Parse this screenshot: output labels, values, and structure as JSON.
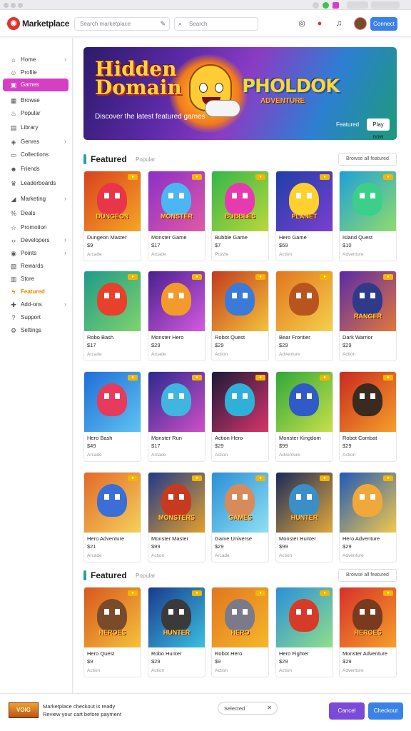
{
  "app": {
    "title": "Marketplace"
  },
  "header": {
    "search_placeholder": "Search marketplace",
    "search2_placeholder": "Search",
    "primary_button": "Connect"
  },
  "sidebar": {
    "items": [
      {
        "label": "Home",
        "icon": "home-icon",
        "chevron": true
      },
      {
        "label": "Profile",
        "icon": "user-icon",
        "chevron": false
      },
      {
        "label": "Games",
        "icon": "gamepad-icon",
        "chevron": false,
        "active": true
      },
      {
        "label": "Browse",
        "icon": "grid-icon",
        "chevron": false
      },
      {
        "label": "Popular",
        "icon": "fire-icon",
        "chevron": false
      },
      {
        "label": "Library",
        "icon": "book-icon",
        "chevron": false
      },
      {
        "label": "Genres",
        "icon": "tag-icon",
        "chevron": true
      },
      {
        "label": "Collections",
        "icon": "folder-icon",
        "chevron": false
      },
      {
        "label": "Friends",
        "icon": "friends-icon",
        "chevron": false
      },
      {
        "label": "Leaderboards",
        "icon": "trophy-icon",
        "chevron": false
      },
      {
        "label": "Marketing",
        "icon": "megaphone-icon",
        "chevron": true
      },
      {
        "label": "Deals",
        "icon": "percent-icon",
        "chevron": false
      },
      {
        "label": "Promotion",
        "icon": "star-icon",
        "chevron": false
      },
      {
        "label": "Developers",
        "icon": "code-icon",
        "chevron": true
      },
      {
        "label": "Points",
        "icon": "coin-icon",
        "chevron": true
      },
      {
        "label": "Rewards",
        "icon": "gift-icon",
        "chevron": false
      },
      {
        "label": "Store",
        "icon": "store-icon",
        "chevron": false
      },
      {
        "label": "Featured",
        "icon": "bolt-icon",
        "chevron": false,
        "highlight": true
      },
      {
        "label": "Add-ons",
        "icon": "puzzle-icon",
        "chevron": true
      },
      {
        "label": "Support",
        "icon": "help-icon",
        "chevron": false
      },
      {
        "label": "Settings",
        "icon": "gear-icon",
        "chevron": false
      }
    ]
  },
  "hero": {
    "title_line1": "Hidden",
    "title_line2": "Domain",
    "logo_text": "PHOLDOK",
    "logo_sub": "ADVENTURE",
    "tagline": "Discover the latest featured games",
    "promo_label": "Featured",
    "button_label": "Play now"
  },
  "sections": [
    {
      "title": "Featured",
      "subtitle": "Popular",
      "button": "Browse all featured",
      "cards": [
        {
          "title": "Dungeon Master",
          "price": "$9",
          "meta": "Arcade",
          "colors": [
            "#d9421f",
            "#f5a623"
          ],
          "blob": "#e8354a",
          "art_text": "DUNGEON"
        },
        {
          "title": "Monster Game",
          "price": "$17",
          "meta": "Arcade",
          "colors": [
            "#8b2fc9",
            "#e259a6"
          ],
          "blob": "#4bb6f2",
          "art_text": "MONSTER"
        },
        {
          "title": "Bubble Game",
          "price": "$7",
          "meta": "Puzzle",
          "colors": [
            "#35b64a",
            "#b8d83b"
          ],
          "blob": "#e83ab0",
          "art_text": "BUBBLES"
        },
        {
          "title": "Hero Game",
          "price": "$69",
          "meta": "Action",
          "colors": [
            "#1e3fa8",
            "#7a3fd0"
          ],
          "blob": "#ffd02e",
          "art_text": "PLANET"
        },
        {
          "title": "Island Quest",
          "price": "$10",
          "meta": "Adventure",
          "colors": [
            "#1fa0d8",
            "#8fdc6a"
          ],
          "blob": "#3ccf8a",
          "art_text": ""
        }
      ]
    },
    {
      "title": "",
      "cards": [
        {
          "title": "Robo Bash",
          "price": "$17",
          "meta": "Arcade",
          "colors": [
            "#1e9b8a",
            "#7fd36b"
          ],
          "blob": "#e8402a",
          "art_text": ""
        },
        {
          "title": "Monster Hero",
          "price": "$29",
          "meta": "Arcade",
          "colors": [
            "#4a1f8f",
            "#d45be0"
          ],
          "blob": "#f29b2a",
          "art_text": ""
        },
        {
          "title": "Robot Quest",
          "price": "$29",
          "meta": "Action",
          "colors": [
            "#c23b1f",
            "#f5c23a"
          ],
          "blob": "#3a7ad8",
          "art_text": ""
        },
        {
          "title": "Bear Frontier",
          "price": "$29",
          "meta": "Adventure",
          "colors": [
            "#e2761f",
            "#f5d04a"
          ],
          "blob": "#b8551f",
          "art_text": ""
        },
        {
          "title": "Dark Warrior",
          "price": "$29",
          "meta": "Action",
          "colors": [
            "#5a2aa8",
            "#e2783a"
          ],
          "blob": "#2f3a8a",
          "art_text": "RANGER"
        }
      ]
    },
    {
      "title": "",
      "cards": [
        {
          "title": "Hero Bash",
          "price": "$49",
          "meta": "Arcade",
          "colors": [
            "#1f6fd8",
            "#5fc2f2"
          ],
          "blob": "#e83a5a",
          "art_text": ""
        },
        {
          "title": "Monster Run",
          "price": "$17",
          "meta": "Arcade",
          "colors": [
            "#2a2a8f",
            "#d04fc8"
          ],
          "blob": "#3fb6e0",
          "art_text": ""
        },
        {
          "title": "Action Hero",
          "price": "$29",
          "meta": "Action",
          "colors": [
            "#1a1a3a",
            "#d8346a"
          ],
          "blob": "#2fb0d8",
          "art_text": ""
        },
        {
          "title": "Monster Kingdom",
          "price": "$99",
          "meta": "Adventure",
          "colors": [
            "#2fa83a",
            "#c8e04a"
          ],
          "blob": "#2f5ac8",
          "art_text": ""
        },
        {
          "title": "Robot Combat",
          "price": "$29",
          "meta": "Action",
          "colors": [
            "#c82a1f",
            "#f5a02a"
          ],
          "blob": "#3a2a1f",
          "art_text": ""
        }
      ]
    },
    {
      "title": "",
      "cards": [
        {
          "title": "Hero Adventure",
          "price": "$21",
          "meta": "Arcade",
          "colors": [
            "#e26a2a",
            "#f5d05a"
          ],
          "blob": "#3a6fd8",
          "art_text": ""
        },
        {
          "title": "Monster Master",
          "price": "$99",
          "meta": "Action",
          "colors": [
            "#1f3a8a",
            "#e2a02a"
          ],
          "blob": "#c83a1f",
          "art_text": "MONSTERS"
        },
        {
          "title": "Game Universe",
          "price": "$29",
          "meta": "Arcade",
          "colors": [
            "#2a8fd8",
            "#8fe0f2"
          ],
          "blob": "#d88a5a",
          "art_text": "GAMES"
        },
        {
          "title": "Monster Hunter",
          "price": "$99",
          "meta": "Action",
          "colors": [
            "#1a2a5a",
            "#e2a83a"
          ],
          "blob": "#3a8fc8",
          "art_text": "HUNTER"
        },
        {
          "title": "Hero Adventure",
          "price": "$29",
          "meta": "Adventure",
          "colors": [
            "#1f5ab8",
            "#f2c84a"
          ],
          "blob": "#f0a83a",
          "art_text": ""
        }
      ]
    },
    {
      "title": "Featured",
      "subtitle": "Popular",
      "button": "Browse all featured",
      "cards": [
        {
          "title": "Hero Quest",
          "price": "$9",
          "meta": "Action",
          "colors": [
            "#d8571f",
            "#f5c23a"
          ],
          "blob": "#7a4b2a",
          "art_text": "HEROES"
        },
        {
          "title": "Robo Hunter",
          "price": "$29",
          "meta": "Action",
          "colors": [
            "#1a3a8f",
            "#3ac0e0"
          ],
          "blob": "#3a3a3a",
          "art_text": "HUNTER"
        },
        {
          "title": "Robot Hero",
          "price": "$9",
          "meta": "Action",
          "colors": [
            "#e2761f",
            "#f5b82a"
          ],
          "blob": "#7a7a8a",
          "art_text": "HERO"
        },
        {
          "title": "Hero Fighter",
          "price": "$29",
          "meta": "Action",
          "colors": [
            "#2a8fd8",
            "#8fe08a"
          ],
          "blob": "#d83a2a",
          "art_text": ""
        },
        {
          "title": "Monster Adventure",
          "price": "$29",
          "meta": "Adventure",
          "colors": [
            "#d8302a",
            "#f5a02a"
          ],
          "blob": "#7a3a1f",
          "art_text": "HEROES"
        }
      ]
    }
  ],
  "bottombar": {
    "thumb_text": "VOIG",
    "line1": "Marketplace checkout is ready",
    "line2": "Review your cart before payment",
    "pill_label": "Selected",
    "btn1": "Cancel",
    "btn2": "Checkout",
    "btn1_color": "#7b4ad8",
    "btn2_color": "#3b82e6"
  }
}
